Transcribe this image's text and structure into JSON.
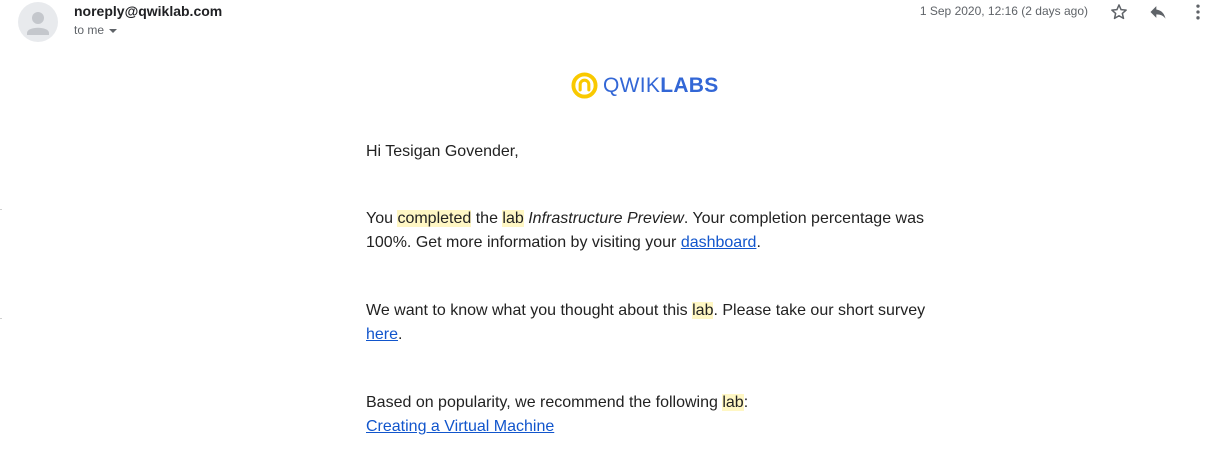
{
  "header": {
    "sender": "noreply@qwiklab.com",
    "recipient_label": "to me",
    "timestamp": "1 Sep 2020, 12:16 (2 days ago)"
  },
  "logo": {
    "part1": "QWIK",
    "part2": "LABS"
  },
  "body": {
    "greeting": "Hi Tesigan Govender,",
    "p1": {
      "t1": "You ",
      "hl1": "completed",
      "t2": " the ",
      "hl2": "lab",
      "t3": " ",
      "lab_name": "Infrastructure Preview",
      "t4": ". Your completion percentage was 100%. Get more information by visiting your ",
      "link": "dashboard",
      "t5": "."
    },
    "p2": {
      "t1": "We want to know what you thought about this ",
      "hl1": "lab",
      "t2": ". Please take our short survey ",
      "link": "here",
      "t3": "."
    },
    "p3": {
      "t1": "Based on popularity, we recommend the following ",
      "hl1": "lab",
      "t2": ":",
      "link": "Creating a Virtual Machine"
    }
  },
  "icons": {
    "avatar": "avatar-placeholder-icon",
    "star": "star-icon",
    "reply": "reply-icon",
    "more": "more-vert-icon",
    "logo": "qwiklabs-logo-icon"
  },
  "colors": {
    "brand_blue": "#3367d6",
    "brand_yellow": "#f9c900",
    "link": "#1155cc",
    "highlight": "#fff7c4"
  }
}
